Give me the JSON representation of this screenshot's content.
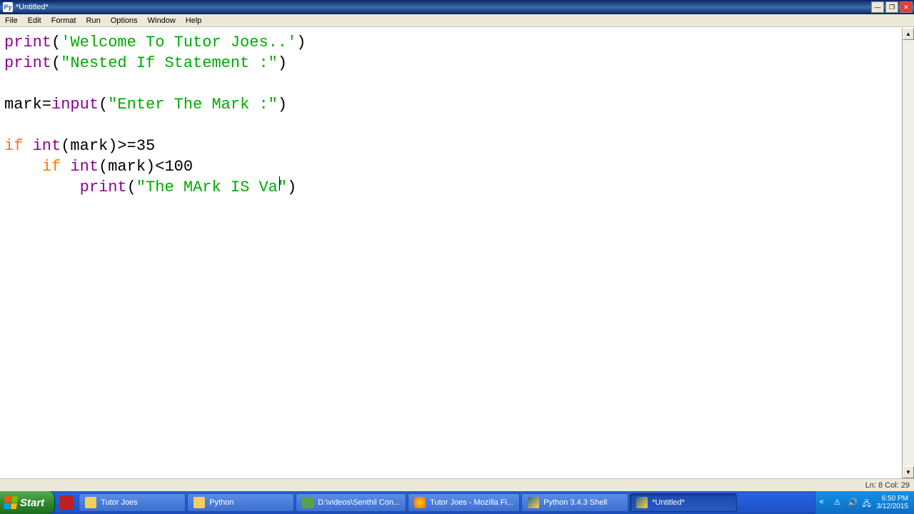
{
  "window": {
    "title": "*Untitled*"
  },
  "menu": {
    "items": [
      "File",
      "Edit",
      "Format",
      "Run",
      "Options",
      "Window",
      "Help"
    ]
  },
  "code": {
    "l1": {
      "fn": "print",
      "p1": "(",
      "s": "'Welcome To Tutor Joes..'",
      "p2": ")"
    },
    "l2": {
      "fn": "print",
      "p1": "(",
      "s": "\"Nested If Statement :\"",
      "p2": ")"
    },
    "l4": {
      "v": "mark=",
      "fn": "input",
      "p1": "(",
      "s": "\"Enter The Mark :\"",
      "p2": ")"
    },
    "l6": {
      "kw": "if",
      "sp": " ",
      "fn": "int",
      "rest": "(mark)>=35"
    },
    "l7": {
      "pad": "    ",
      "kw": "if",
      "sp": " ",
      "fn": "int",
      "rest": "(mark)<100"
    },
    "l8": {
      "pad": "        ",
      "fn": "print",
      "p1": "(",
      "s": "\"The MArk IS Va\"",
      "p2": ")"
    }
  },
  "status": {
    "pos": "Ln: 8 Col: 29"
  },
  "taskbar": {
    "start": "Start",
    "items": [
      {
        "label": "Tutor Joes",
        "color": "#f0d060"
      },
      {
        "label": "Python",
        "color": "#f0d060"
      },
      {
        "label": "D:\\videos\\Senthil Con...",
        "color": "#5aa050"
      },
      {
        "label": "Tutor Joes - Mozilla Fi...",
        "color": "#e07020"
      },
      {
        "label": "Python 3.4.3 Shell",
        "color": "#d8e8f8"
      },
      {
        "label": "*Untitled*",
        "color": "#d8e8f8",
        "active": true
      }
    ]
  },
  "systray": {
    "time": "6:50 PM",
    "date": "3/12/2015"
  }
}
